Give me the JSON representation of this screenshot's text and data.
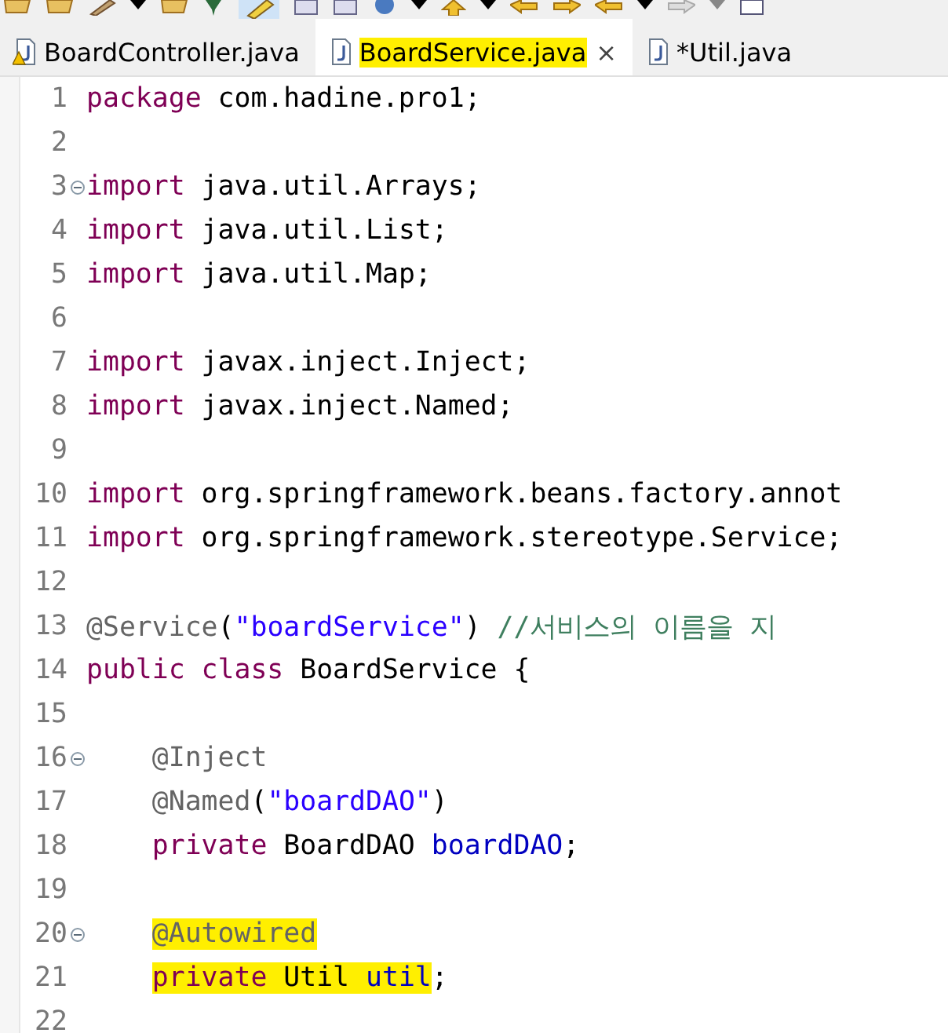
{
  "tabs": [
    {
      "label": "BoardController.java",
      "selected": false,
      "highlighted": false,
      "warning": true
    },
    {
      "label": "BoardService.java",
      "selected": true,
      "highlighted": true,
      "warning": false,
      "close": "×"
    },
    {
      "label": "*Util.java",
      "selected": false,
      "highlighted": false,
      "warning": false
    }
  ],
  "lines": [
    {
      "number": "1",
      "fold": false,
      "tokens": [
        {
          "kind": "keyword",
          "text": "package"
        },
        {
          "kind": "plain",
          "text": " com.hadine.pro1;"
        }
      ]
    },
    {
      "number": "2",
      "fold": false
    },
    {
      "number": "3",
      "fold": true,
      "tokens": [
        {
          "kind": "keyword",
          "text": "import"
        },
        {
          "kind": "plain",
          "text": " java.util.Arrays;"
        }
      ]
    },
    {
      "number": "4",
      "fold": false,
      "tokens": [
        {
          "kind": "keyword",
          "text": "import"
        },
        {
          "kind": "plain",
          "text": " java.util.List;"
        }
      ]
    },
    {
      "number": "5",
      "fold": false,
      "tokens": [
        {
          "kind": "keyword",
          "text": "import"
        },
        {
          "kind": "plain",
          "text": " java.util.Map;"
        }
      ]
    },
    {
      "number": "6",
      "fold": false
    },
    {
      "number": "7",
      "fold": false,
      "tokens": [
        {
          "kind": "keyword",
          "text": "import"
        },
        {
          "kind": "plain",
          "text": " javax.inject.Inject;"
        }
      ]
    },
    {
      "number": "8",
      "fold": false,
      "tokens": [
        {
          "kind": "keyword",
          "text": "import"
        },
        {
          "kind": "plain",
          "text": " javax.inject.Named;"
        }
      ]
    },
    {
      "number": "9",
      "fold": false
    },
    {
      "number": "10",
      "fold": false,
      "tokens": [
        {
          "kind": "keyword",
          "text": "import"
        },
        {
          "kind": "plain",
          "text": " org.springframework.beans.factory.annot"
        }
      ]
    },
    {
      "number": "11",
      "fold": false,
      "tokens": [
        {
          "kind": "keyword",
          "text": "import"
        },
        {
          "kind": "plain",
          "text": " org.springframework.stereotype.Service;"
        }
      ]
    },
    {
      "number": "12",
      "fold": false
    },
    {
      "number": "13",
      "fold": false,
      "tokens": [
        {
          "kind": "annotation",
          "text": "@Service"
        },
        {
          "kind": "plain",
          "text": "("
        },
        {
          "kind": "string",
          "text": "\"boardService\""
        },
        {
          "kind": "plain",
          "text": ") "
        },
        {
          "kind": "comment",
          "text": "//서비스의 이름을 지"
        }
      ]
    },
    {
      "number": "14",
      "fold": false,
      "tokens": [
        {
          "kind": "keyword",
          "text": "public class"
        },
        {
          "kind": "plain",
          "text": " BoardService {"
        }
      ]
    },
    {
      "number": "15",
      "fold": false
    },
    {
      "number": "16",
      "fold": true,
      "indent": true,
      "tokens": [
        {
          "kind": "annotation",
          "text": "@Inject"
        }
      ]
    },
    {
      "number": "17",
      "fold": false,
      "indent": true,
      "tokens": [
        {
          "kind": "annotation",
          "text": "@Named"
        },
        {
          "kind": "plain",
          "text": "("
        },
        {
          "kind": "string",
          "text": "\"boardDAO\""
        },
        {
          "kind": "plain",
          "text": ")"
        }
      ]
    },
    {
      "number": "18",
      "fold": false,
      "indent": true,
      "tokens": [
        {
          "kind": "keyword",
          "text": "private"
        },
        {
          "kind": "plain",
          "text": " BoardDAO "
        },
        {
          "kind": "field",
          "text": "boardDAO"
        },
        {
          "kind": "plain",
          "text": ";"
        }
      ]
    },
    {
      "number": "19",
      "fold": false
    },
    {
      "number": "20",
      "fold": true,
      "indent": true,
      "tokens": [
        {
          "kind": "annotation",
          "text": "@Autowired",
          "highlighted": true
        }
      ]
    },
    {
      "number": "21",
      "fold": false,
      "indent": true,
      "tokens": [
        {
          "kind": "keyword",
          "text": "private",
          "highlighted": true
        },
        {
          "kind": "plain",
          "text": " Util ",
          "highlighted": true
        },
        {
          "kind": "field",
          "text": "util",
          "highlighted": true
        },
        {
          "kind": "plain",
          "text": ";"
        }
      ]
    },
    {
      "number": "22",
      "fold": false
    }
  ]
}
